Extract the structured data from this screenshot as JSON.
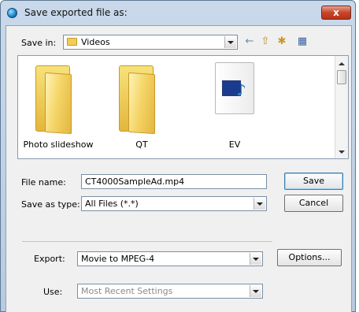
{
  "window": {
    "title": "Save exported file as:",
    "close_label": "x"
  },
  "save_in": {
    "label": "Save in:",
    "value": "Videos"
  },
  "toolbar": {
    "back_icon": "←",
    "up_folder_icon": "⇧",
    "new_folder_icon": "✱",
    "views_icon": "▦"
  },
  "files": [
    {
      "label": "Photo slideshow",
      "type": "folder"
    },
    {
      "label": "QT",
      "type": "folder"
    },
    {
      "label": "EV",
      "type": "video-file"
    }
  ],
  "file_name": {
    "label": "File name:",
    "value": "CT4000SampleAd.mp4"
  },
  "save_as_type": {
    "label": "Save as type:",
    "value": "All Files (*.*)"
  },
  "buttons": {
    "save": "Save",
    "cancel": "Cancel",
    "options": "Options..."
  },
  "export": {
    "label": "Export:",
    "value": "Movie to MPEG-4"
  },
  "use": {
    "label": "Use:",
    "value": "Most Recent Settings"
  }
}
